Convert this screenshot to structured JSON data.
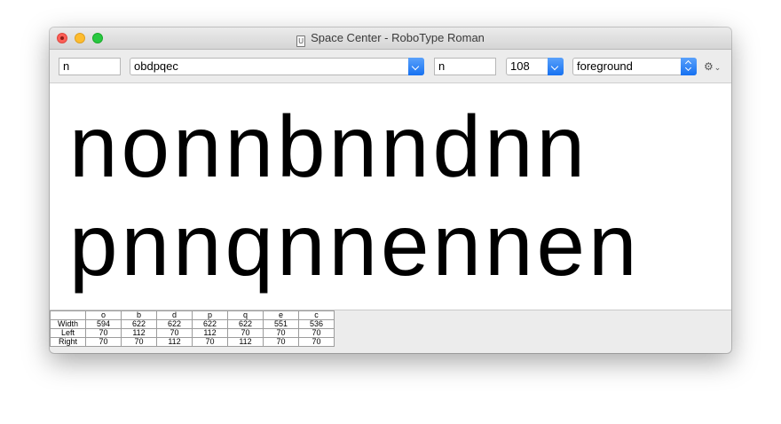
{
  "window": {
    "title": "Space Center - RoboType Roman",
    "doc_icon_glyph": "U"
  },
  "toolbar": {
    "pre_text": "n",
    "glyphs_text": "obdpqec",
    "after_text": "n",
    "point_size": "108",
    "layer": "foreground",
    "settings_icon": "gear-icon"
  },
  "preview": {
    "line1": "nonnbnndnn",
    "line2": "pnnqnnennen"
  },
  "metrics": {
    "glyphs": [
      "o",
      "b",
      "d",
      "p",
      "q",
      "e",
      "c"
    ],
    "rows": [
      {
        "label": "Width",
        "values": [
          "594",
          "622",
          "622",
          "622",
          "622",
          "551",
          "536"
        ]
      },
      {
        "label": "Left",
        "values": [
          "70",
          "112",
          "70",
          "112",
          "70",
          "70",
          "70"
        ]
      },
      {
        "label": "Right",
        "values": [
          "70",
          "70",
          "112",
          "70",
          "112",
          "70",
          "70"
        ]
      }
    ]
  }
}
